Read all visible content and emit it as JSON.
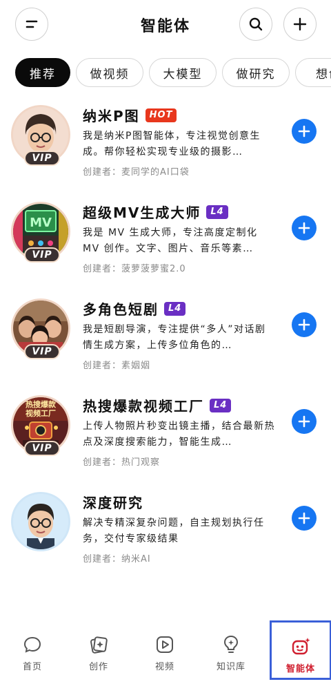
{
  "header": {
    "title": "智能体",
    "menu_icon": "menu-icon",
    "search_icon": "search-icon",
    "add_icon": "plus-icon"
  },
  "tabs": [
    {
      "label": "推荐",
      "active": true
    },
    {
      "label": "做视频",
      "active": false
    },
    {
      "label": "大模型",
      "active": false
    },
    {
      "label": "做研究",
      "active": false
    },
    {
      "label": "想创",
      "active": false
    }
  ],
  "agents": [
    {
      "name": "纳米P图",
      "badge": "HOT",
      "vip": "VIP",
      "description": "我是纳米P图智能体，专注视觉创意生成。帮你轻松实现专业级的摄影…",
      "creator": "创建者：麦同学的AI口袋"
    },
    {
      "name": "超级MV生成大师",
      "badge": "L4",
      "vip": "VIP",
      "description": "我是 MV 生成大师，专注高度定制化 MV 创作。文字、图片、音乐等素…",
      "creator": "创建者：菠萝菠萝蜜2.0"
    },
    {
      "name": "多角色短剧",
      "badge": "L4",
      "vip": "VIP",
      "description": "我是短剧导演，专注提供“多人”对话剧情生成方案，上传多位角色的…",
      "creator": "创建者：素姻姻"
    },
    {
      "name": "热搜爆款视频工厂",
      "badge": "L4",
      "vip": "VIP",
      "avatar_text": "热搜爆款视频工厂",
      "description": "上传人物照片秒变出镜主播，结合最新热点及深度搜索能力，智能生成…",
      "creator": "创建者：热门观察"
    },
    {
      "name": "深度研究",
      "badge": "",
      "vip": "",
      "description": "解决专精深复杂问题，自主规划执行任务，交付专家级结果",
      "creator": "创建者：纳米AI"
    }
  ],
  "bottom_nav": [
    {
      "label": "首页",
      "icon": "chat-bubble-icon",
      "active": false
    },
    {
      "label": "创作",
      "icon": "sparkle-cards-icon",
      "active": false
    },
    {
      "label": "视频",
      "icon": "play-icon",
      "active": false
    },
    {
      "label": "知识库",
      "icon": "lightbulb-icon",
      "active": false
    },
    {
      "label": "智能体",
      "icon": "robot-icon",
      "active": true
    }
  ],
  "colors": {
    "accent_blue": "#1676f2",
    "hot_badge": "#e8371d",
    "l4_badge": "#6a2fc3",
    "active_nav": "#d01f2f",
    "active_tab_bg": "#0a0a0a"
  }
}
